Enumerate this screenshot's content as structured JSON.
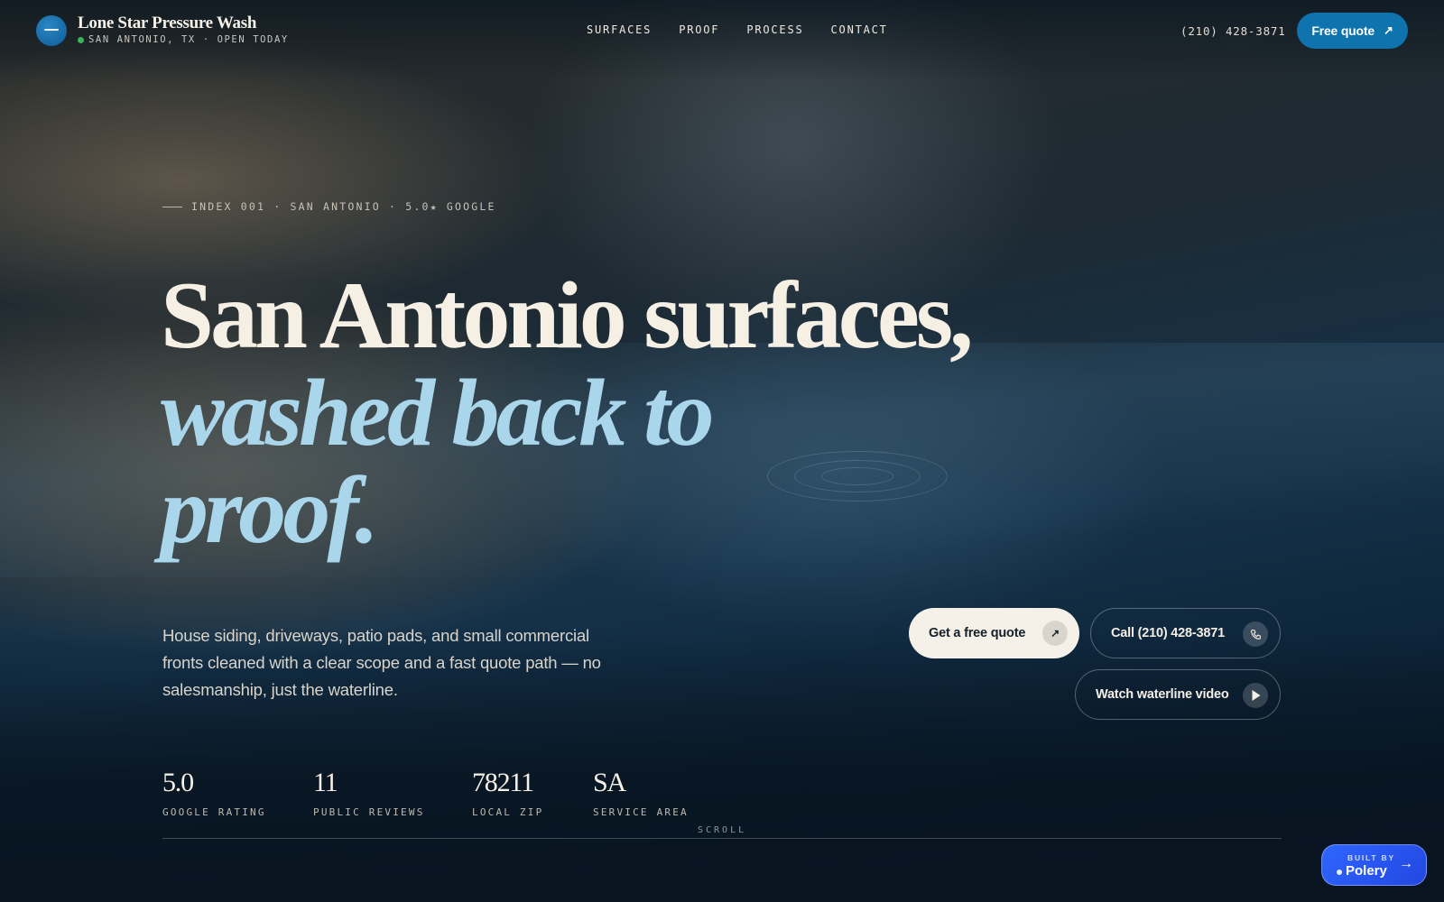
{
  "header": {
    "brand_name": "Lone Star Pressure Wash",
    "brand_subtitle": "SAN ANTONIO, TX · OPEN TODAY",
    "nav": [
      "SURFACES",
      "PROOF",
      "PROCESS",
      "CONTACT"
    ],
    "phone": "(210) 428-3871",
    "quote_button": "Free quote"
  },
  "hero": {
    "eyebrow": "INDEX 001 · SAN ANTONIO · 5.0★ GOOGLE",
    "headline_line1": "San Antonio surfaces,",
    "headline_line2": "washed back to",
    "headline_line3": "proof.",
    "lede": "House siding, driveways, patio pads, and small commercial fronts cleaned with a clear scope and a fast quote path — no salesmanship, just the waterline.",
    "cta_primary": "Get a free quote",
    "cta_call": "Call (210) 428-3871",
    "cta_video": "Watch waterline video"
  },
  "stats": [
    {
      "value": "5.0",
      "label": "GOOGLE RATING"
    },
    {
      "value": "11",
      "label": "PUBLIC REVIEWS"
    },
    {
      "value": "78211",
      "label": "LOCAL ZIP"
    },
    {
      "value": "SA",
      "label": "SERVICE AREA"
    }
  ],
  "scroll_label": "SCROLL",
  "badge": {
    "built_by": "BUILT BY",
    "name": "Polery"
  },
  "colors": {
    "accent": "#0f74ad",
    "headline_italic": "#aad6ec",
    "cream": "#f6f1e8",
    "badge": "#2f66ff",
    "status_open": "#3bb25a"
  },
  "icons": [
    "logo-mark-icon",
    "arrow-up-right-icon",
    "phone-icon",
    "play-icon",
    "arrow-right-icon"
  ]
}
